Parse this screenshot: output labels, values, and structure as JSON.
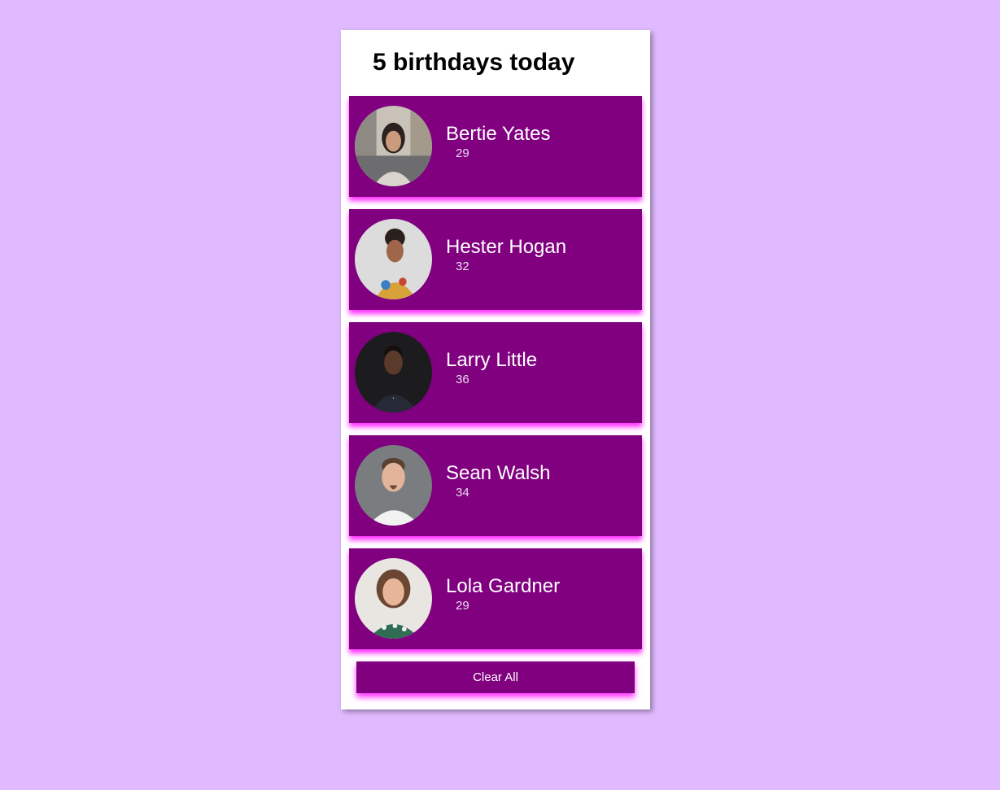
{
  "title": "5 birthdays today",
  "people": [
    {
      "name": "Bertie Yates",
      "age": "29"
    },
    {
      "name": "Hester Hogan",
      "age": "32"
    },
    {
      "name": "Larry Little",
      "age": "36"
    },
    {
      "name": "Sean Walsh",
      "age": "34"
    },
    {
      "name": "Lola Gardner",
      "age": "29"
    }
  ],
  "clear_button_label": "Clear All",
  "colors": {
    "page_background": "#e0baff",
    "accent": "#800080",
    "glow": "#ff33ff"
  }
}
